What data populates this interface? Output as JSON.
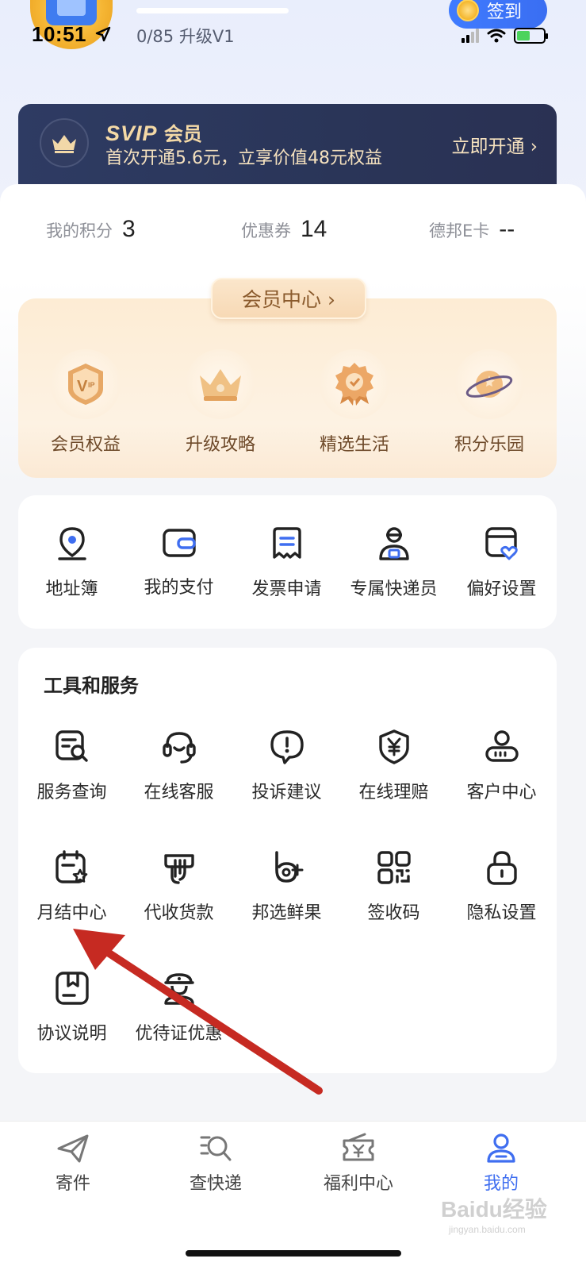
{
  "status_bar": {
    "time": "10:51"
  },
  "profile": {
    "level_progress": "0/85 升级V1",
    "signin_label": "签到"
  },
  "svip": {
    "title_brand": "SVIP",
    "title_suffix": "会员",
    "description": "首次开通5.6元，立享价值48元权益",
    "cta": "立即开通 ›"
  },
  "stats": [
    {
      "label": "我的积分",
      "value": "3"
    },
    {
      "label": "优惠券",
      "value": "14"
    },
    {
      "label": "德邦E卡",
      "value": "--"
    }
  ],
  "member_center": {
    "tab_label": "会员中心 ›",
    "items": [
      {
        "label": "会员权益",
        "icon": "vip-badge-icon"
      },
      {
        "label": "升级攻略",
        "icon": "crown-icon"
      },
      {
        "label": "精选生活",
        "icon": "medal-icon"
      },
      {
        "label": "积分乐园",
        "icon": "planet-icon"
      }
    ]
  },
  "quick_actions": [
    {
      "label": "地址簿",
      "icon": "location-pin-icon"
    },
    {
      "label": "我的支付",
      "icon": "wallet-icon"
    },
    {
      "label": "发票申请",
      "icon": "invoice-icon"
    },
    {
      "label": "专属快递员",
      "icon": "courier-icon"
    },
    {
      "label": "偏好设置",
      "icon": "preference-card-icon"
    }
  ],
  "tools": {
    "title": "工具和服务",
    "items": [
      {
        "label": "服务查询",
        "icon": "service-search-icon"
      },
      {
        "label": "在线客服",
        "icon": "headset-icon"
      },
      {
        "label": "投诉建议",
        "icon": "complaint-icon"
      },
      {
        "label": "在线理赔",
        "icon": "shield-yen-icon"
      },
      {
        "label": "客户中心",
        "icon": "customer-icon"
      },
      {
        "label": "月结中心",
        "icon": "calendar-star-icon"
      },
      {
        "label": "代收货款",
        "icon": "collect-payment-icon"
      },
      {
        "label": "邦选鲜果",
        "icon": "fruit-icon"
      },
      {
        "label": "签收码",
        "icon": "qr-code-icon"
      },
      {
        "label": "隐私设置",
        "icon": "lock-icon"
      },
      {
        "label": "协议说明",
        "icon": "agreement-icon"
      },
      {
        "label": "优待证优惠",
        "icon": "military-cap-icon"
      }
    ]
  },
  "bottom_nav": [
    {
      "label": "寄件",
      "icon": "send-icon",
      "active": false
    },
    {
      "label": "查快递",
      "icon": "track-icon",
      "active": false
    },
    {
      "label": "福利中心",
      "icon": "ticket-icon",
      "active": false
    },
    {
      "label": "我的",
      "icon": "user-icon",
      "active": true
    }
  ],
  "colors": {
    "accent": "#3f6ef0",
    "svip_bg": "#2c3760",
    "svip_gold": "#f4d9a6",
    "annotation_arrow": "#c62a22"
  },
  "watermark": {
    "brand": "Baidu经验",
    "domain": "jingyan.baidu.com"
  }
}
